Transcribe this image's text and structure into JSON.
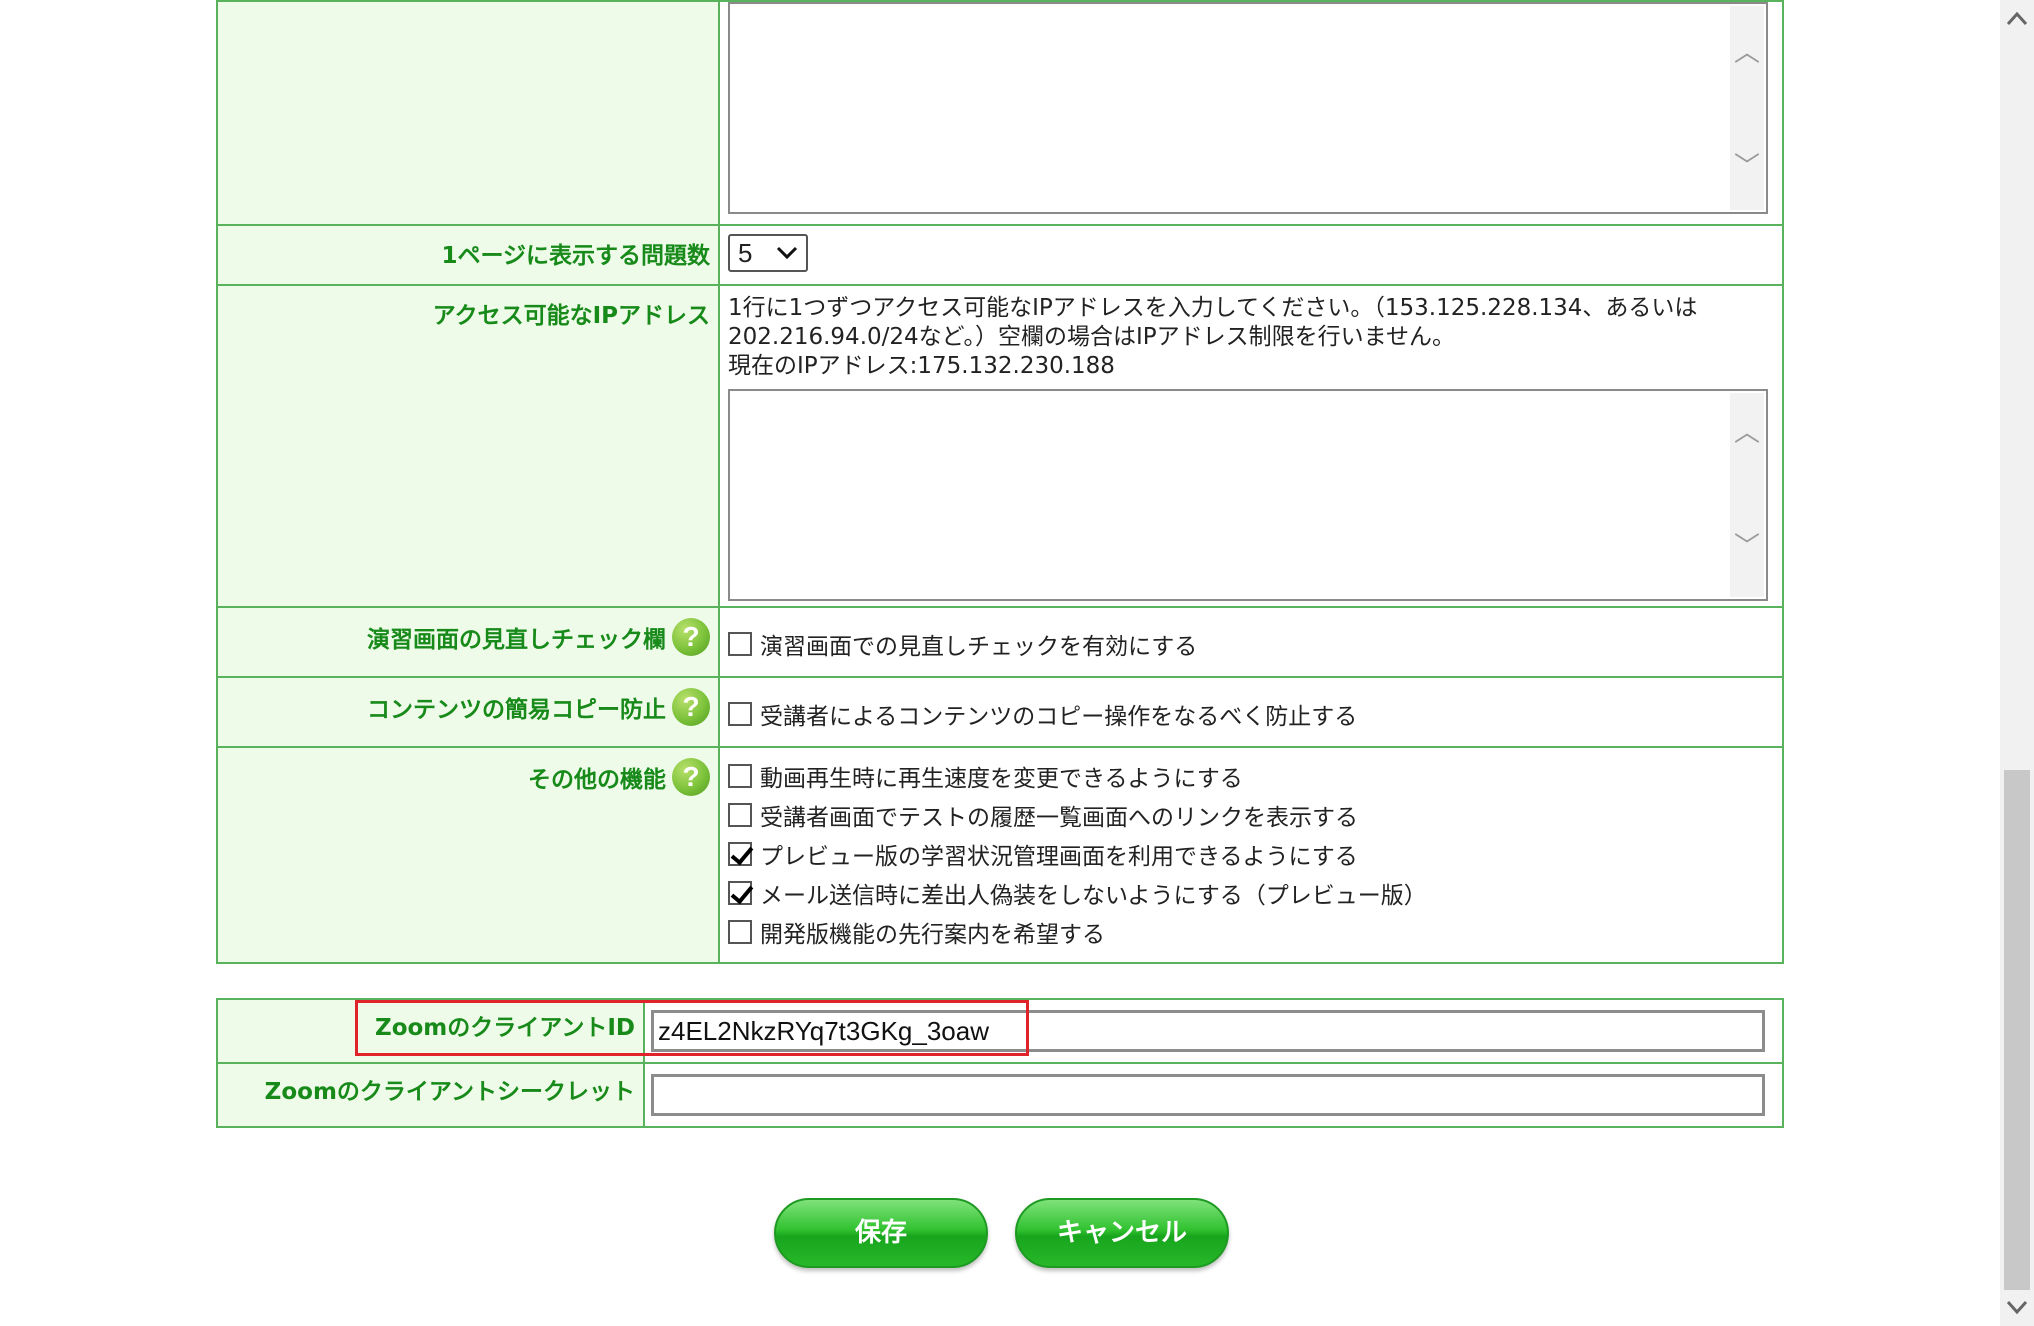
{
  "settings": {
    "questions_per_page": {
      "label": "1ページに表示する問題数",
      "selected": "5"
    },
    "ip_address": {
      "label": "アクセス可能なIPアドレス",
      "description_line1": "1行に1つずつアクセス可能なIPアドレスを入力してください。（153.125.228.134、あるいは",
      "description_line2": "202.216.94.0/24など。）空欄の場合はIPアドレス制限を行いません。",
      "current_ip": "現在のIPアドレス:175.132.230.188"
    },
    "review_check": {
      "label": "演習画面の見直しチェック欄",
      "option": "演習画面での見直しチェックを有効にする",
      "checked": false
    },
    "copy_protection": {
      "label": "コンテンツの簡易コピー防止",
      "option": "受講者によるコンテンツのコピー操作をなるべく防止する",
      "checked": false
    },
    "other_features": {
      "label": "その他の機能",
      "options": [
        {
          "text": "動画再生時に再生速度を変更できるようにする",
          "checked": false
        },
        {
          "text": "受講者画面でテストの履歴一覧画面へのリンクを表示する",
          "checked": false
        },
        {
          "text": "プレビュー版の学習状況管理画面を利用できるようにする",
          "checked": true
        },
        {
          "text": "メール送信時に差出人偽装をしないようにする（プレビュー版）",
          "checked": true
        },
        {
          "text": "開発版機能の先行案内を希望する",
          "checked": false
        }
      ]
    },
    "help_icon_glyph": "?"
  },
  "zoom": {
    "client_id_label": "ZoomのクライアントID",
    "client_id_value": "z4EL2NkzRYq7t3GKg_3oaw",
    "client_secret_label": "Zoomのクライアントシークレット",
    "client_secret_value": ""
  },
  "buttons": {
    "save": "保存",
    "cancel": "キャンセル"
  },
  "icons": {
    "help": "help-icon",
    "select": "chevron-down-icon",
    "scroll_up": "chevron-up-icon",
    "scroll_down": "chevron-down-icon"
  },
  "colors": {
    "label_text": "#178a1a",
    "label_bg": "#effbe9",
    "border": "#59b25c",
    "button_green": "#27b829",
    "highlight": "#e0232b"
  }
}
